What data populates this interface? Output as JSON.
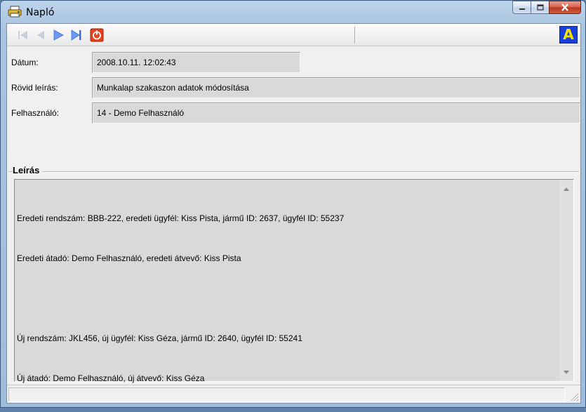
{
  "window": {
    "title": "Napló",
    "icon": "printer-icon",
    "controls": [
      "minimize-icon",
      "maximize-icon",
      "close-icon"
    ]
  },
  "toolbar": {
    "buttons": [
      "first-record-icon",
      "previous-record-icon",
      "next-record-icon",
      "last-record-icon",
      "exit-icon"
    ],
    "right_button_label": "A"
  },
  "form": {
    "datum_label": "Dátum:",
    "datum_value": "2008.10.11. 12:02:43",
    "rovid_label": "Rövid leírás:",
    "rovid_value": "Munkalap szakaszon adatok módosítása",
    "felhasznalo_label": "Felhasználó:",
    "felhasznalo_value": "14 - Demo Felhasználó"
  },
  "leiras": {
    "title": "Leírás",
    "lines": [
      "Eredeti rendszám: BBB-222, eredeti ügyfél: Kiss Pista, jármű ID: 2637, ügyfél ID: 55237",
      "Eredeti átadó: Demo Felhasználó, eredeti átvevő: Kiss Pista",
      "",
      "Új rendszám: JKL456, új ügyfél: Kiss Géza, jármű ID: 2640, ügyfél ID: 55241",
      "Új átadó: Demo Felhasználó, új átvevő: Kiss Géza"
    ]
  },
  "statusbar": {
    "text": ""
  },
  "colors": {
    "field_bg": "#d9d9d9",
    "next_arrow": "#5a8cf0",
    "exit_button": "#e2421c",
    "font_button_bg": "#1a3fd8",
    "font_button_fg": "#f7e100"
  }
}
